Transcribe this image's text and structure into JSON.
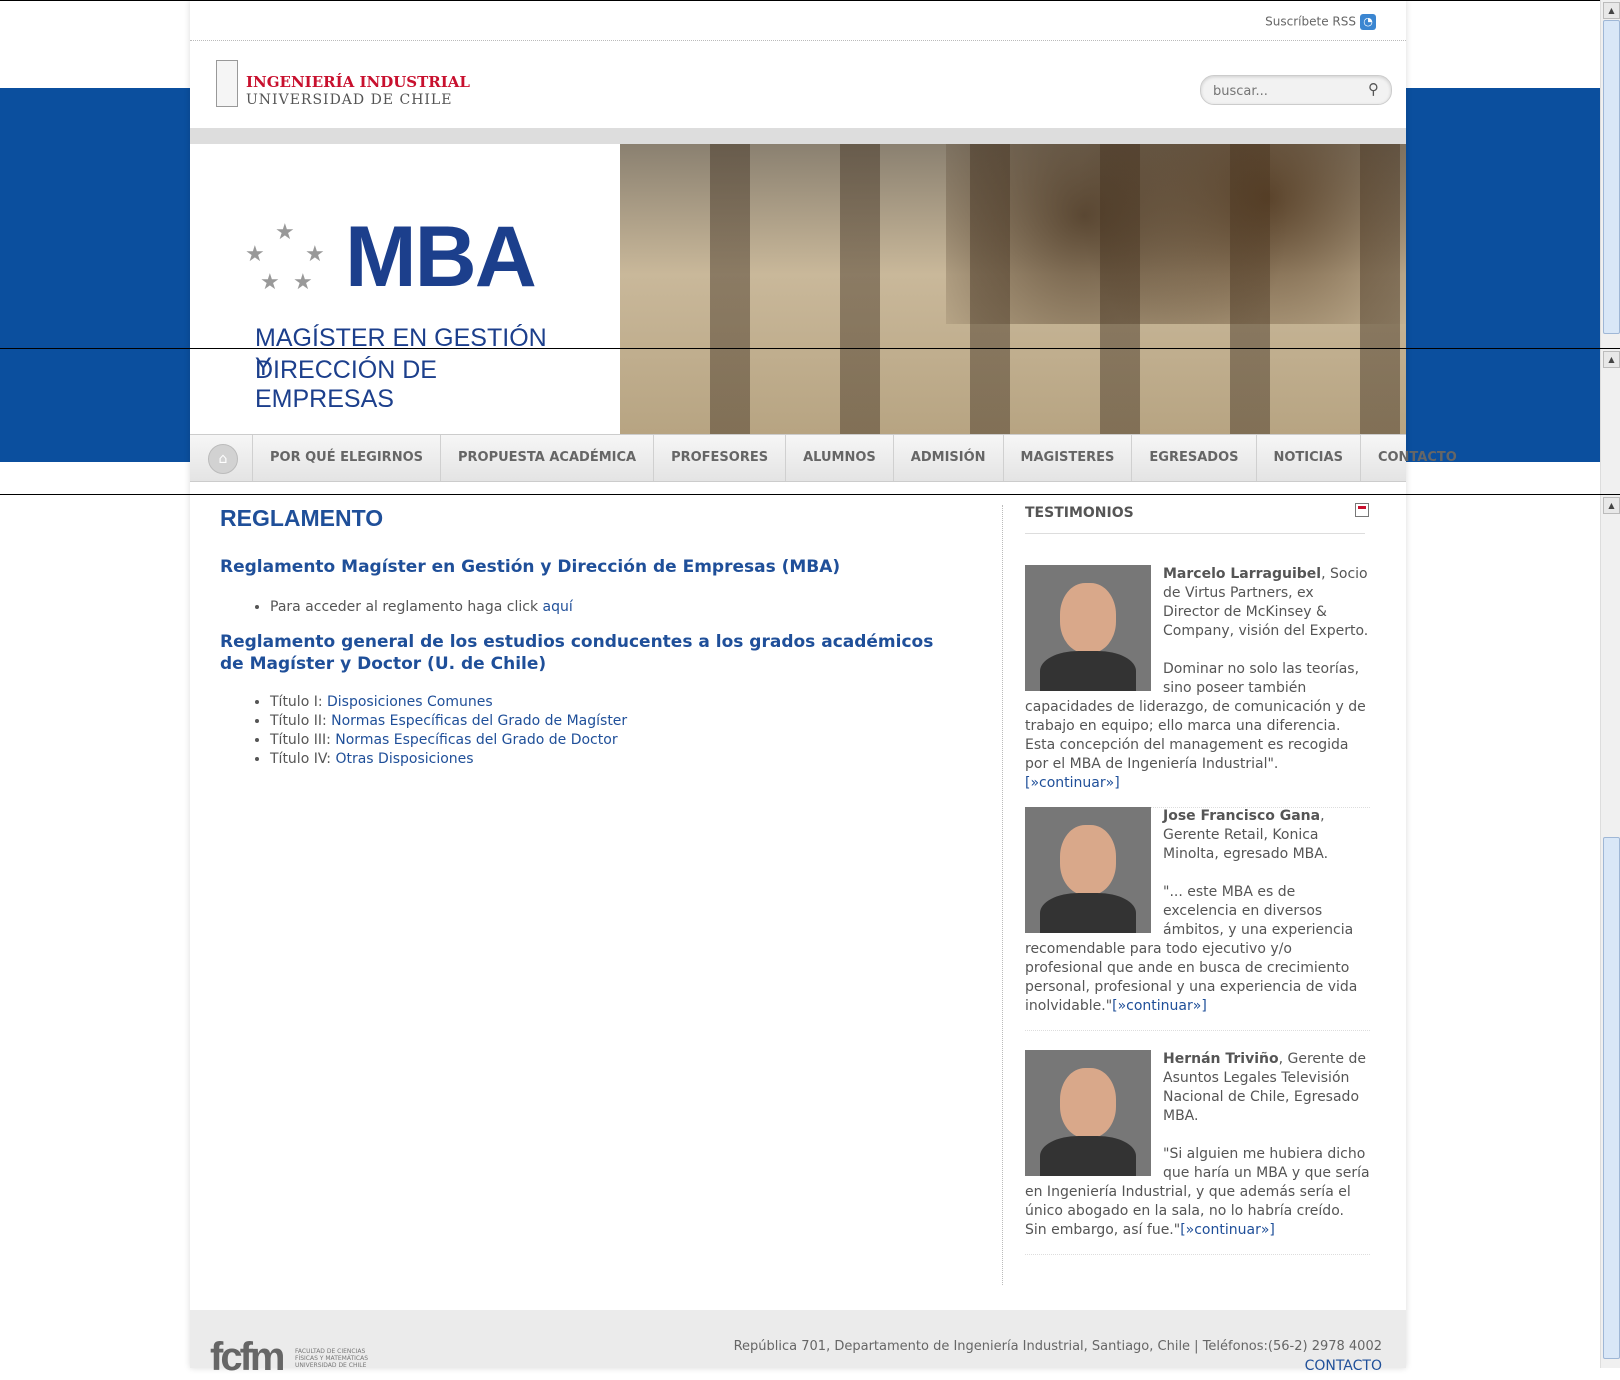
{
  "topbar": {
    "rss_label": "Suscríbete RSS",
    "rss_icon": "rss-icon"
  },
  "logo": {
    "line1": "INGENIERÍA INDUSTRIAL",
    "line2": "UNIVERSIDAD DE CHILE"
  },
  "search": {
    "placeholder": "buscar...",
    "icon": "search-icon"
  },
  "banner": {
    "mba_title": "MBA",
    "mba_subtitle_1": "MAGÍSTER EN GESTIÓN Y",
    "mba_subtitle_2": "DIRECCIÓN DE EMPRESAS"
  },
  "nav": {
    "home_icon": "home-icon",
    "items": [
      "POR QUÉ ELEGIRNOS",
      "PROPUESTA ACADÉMICA",
      "PROFESORES",
      "ALUMNOS",
      "ADMISIÓN",
      "MAGISTERES",
      "EGRESADOS",
      "NOTICIAS",
      "CONTACTO"
    ]
  },
  "main": {
    "title": "REGLAMENTO",
    "section1": {
      "heading": "Reglamento Magíster en Gestión y Dirección de Empresas (MBA)",
      "text": "Para acceder al reglamento haga click ",
      "link": "aquí"
    },
    "section2": {
      "heading": "Reglamento general de los estudios conducentes a los grados académicos de Magíster y Doctor (U. de Chile)",
      "items": [
        {
          "prefix": "Título I: ",
          "link": "Disposiciones Comunes"
        },
        {
          "prefix": "Título II: ",
          "link": "Normas Específicas del Grado de Magíster"
        },
        {
          "prefix": "Título III: ",
          "link": "Normas Específicas del Grado de Doctor"
        },
        {
          "prefix": "Título IV: ",
          "link": "Otras Disposiciones"
        }
      ]
    }
  },
  "sidebar": {
    "title": "TESTIMONIOS",
    "testimonials": [
      {
        "name": "Marcelo Larraguibel",
        "role": ", Socio de Virtus Partners, ex Director de McKinsey & Company, visión del Experto.",
        "quote": "Dominar no solo las teorías, sino poseer también capacidades de liderazgo, de comunicación y de trabajo en equipo; ello marca una diferencia. Esta concepción del management es recogida por el MBA de Ingeniería Industrial\".",
        "more": "[»continuar»]"
      },
      {
        "name": "Jose Francisco Gana",
        "role": ", Gerente Retail, Konica Minolta, egresado MBA.",
        "quote": "\"... este MBA es de excelencia en diversos ámbitos, y una experiencia recomendable para todo ejecutivo y/o profesional que ande en busca de crecimiento personal, profesional y una experiencia de vida inolvidable.\"",
        "more": "[»continuar»]"
      },
      {
        "name": "Hernán Triviño",
        "role": ", Gerente de Asuntos Legales Televisión Nacional de Chile, Egresado MBA.",
        "quote": "\"Si alguien me hubiera dicho que haría un MBA y que sería en Ingeniería Industrial, y que además sería el único abogado en la sala, no lo habría creído. Sin embargo, así fue.\"",
        "more": "[»continuar»]"
      }
    ]
  },
  "footer": {
    "logo_text": "fcfm",
    "logo_sub": "FACULTAD DE CIENCIAS FÍSICAS Y MATEMÁTICAS UNIVERSIDAD DE CHILE",
    "address": "República 701, Departamento de Ingeniería Industrial, Santiago, Chile | Teléfonos:(56-2) 2978 4002",
    "contact": "CONTACTO"
  },
  "colors": {
    "brand_blue": "#0b4f9e",
    "heading_blue": "#1f4f99",
    "logo_red": "#c8102e"
  }
}
